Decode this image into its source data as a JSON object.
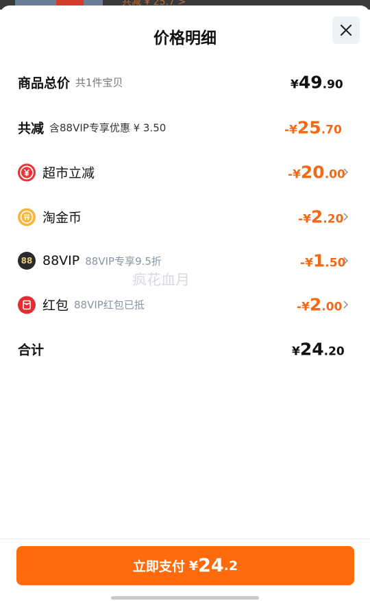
{
  "background_peek": {
    "text": "共减 ¥ 25.7 >"
  },
  "header": {
    "title": "价格明细",
    "close_icon": "close-icon"
  },
  "rows": [
    {
      "label": "商品总价",
      "sub": "共1件宝贝",
      "currency": "¥",
      "int": "49",
      "dec": ".90",
      "sign": ""
    },
    {
      "label": "共减",
      "sub": "含88VIP专享优惠 ¥ 3.50",
      "currency": "¥",
      "int": "25",
      "dec": ".70",
      "sign": "-"
    },
    {
      "label": "超市立减",
      "sub": "",
      "currency": "¥",
      "int": "20",
      "dec": ".00",
      "sign": "-",
      "icon": "yuan-coin-icon"
    },
    {
      "label": "淘金币",
      "sub": "",
      "currency": "¥",
      "int": "2",
      "dec": ".20",
      "sign": "-",
      "icon": "gold-coin-icon"
    },
    {
      "label": "88VIP",
      "sub": "88VIP专享9.5折",
      "currency": "¥",
      "int": "1",
      "dec": ".50",
      "sign": "-",
      "icon": "vip-88-icon",
      "icon_text": "88"
    },
    {
      "label": "红包",
      "sub": "88VIP红包已抵",
      "currency": "¥",
      "int": "2",
      "dec": ".00",
      "sign": "-",
      "icon": "red-packet-icon"
    },
    {
      "label": "合计",
      "sub": "",
      "currency": "¥",
      "int": "24",
      "dec": ".20",
      "sign": ""
    }
  ],
  "footer": {
    "pay_label": "立即支付",
    "pay_currency": "¥",
    "pay_int": "24",
    "pay_dec": ".2"
  },
  "watermark": "疯花血月",
  "colors": {
    "accent": "#ff6a0a",
    "discount": "#f06a18",
    "text": "#111111",
    "sub_text": "#8a94a4"
  }
}
